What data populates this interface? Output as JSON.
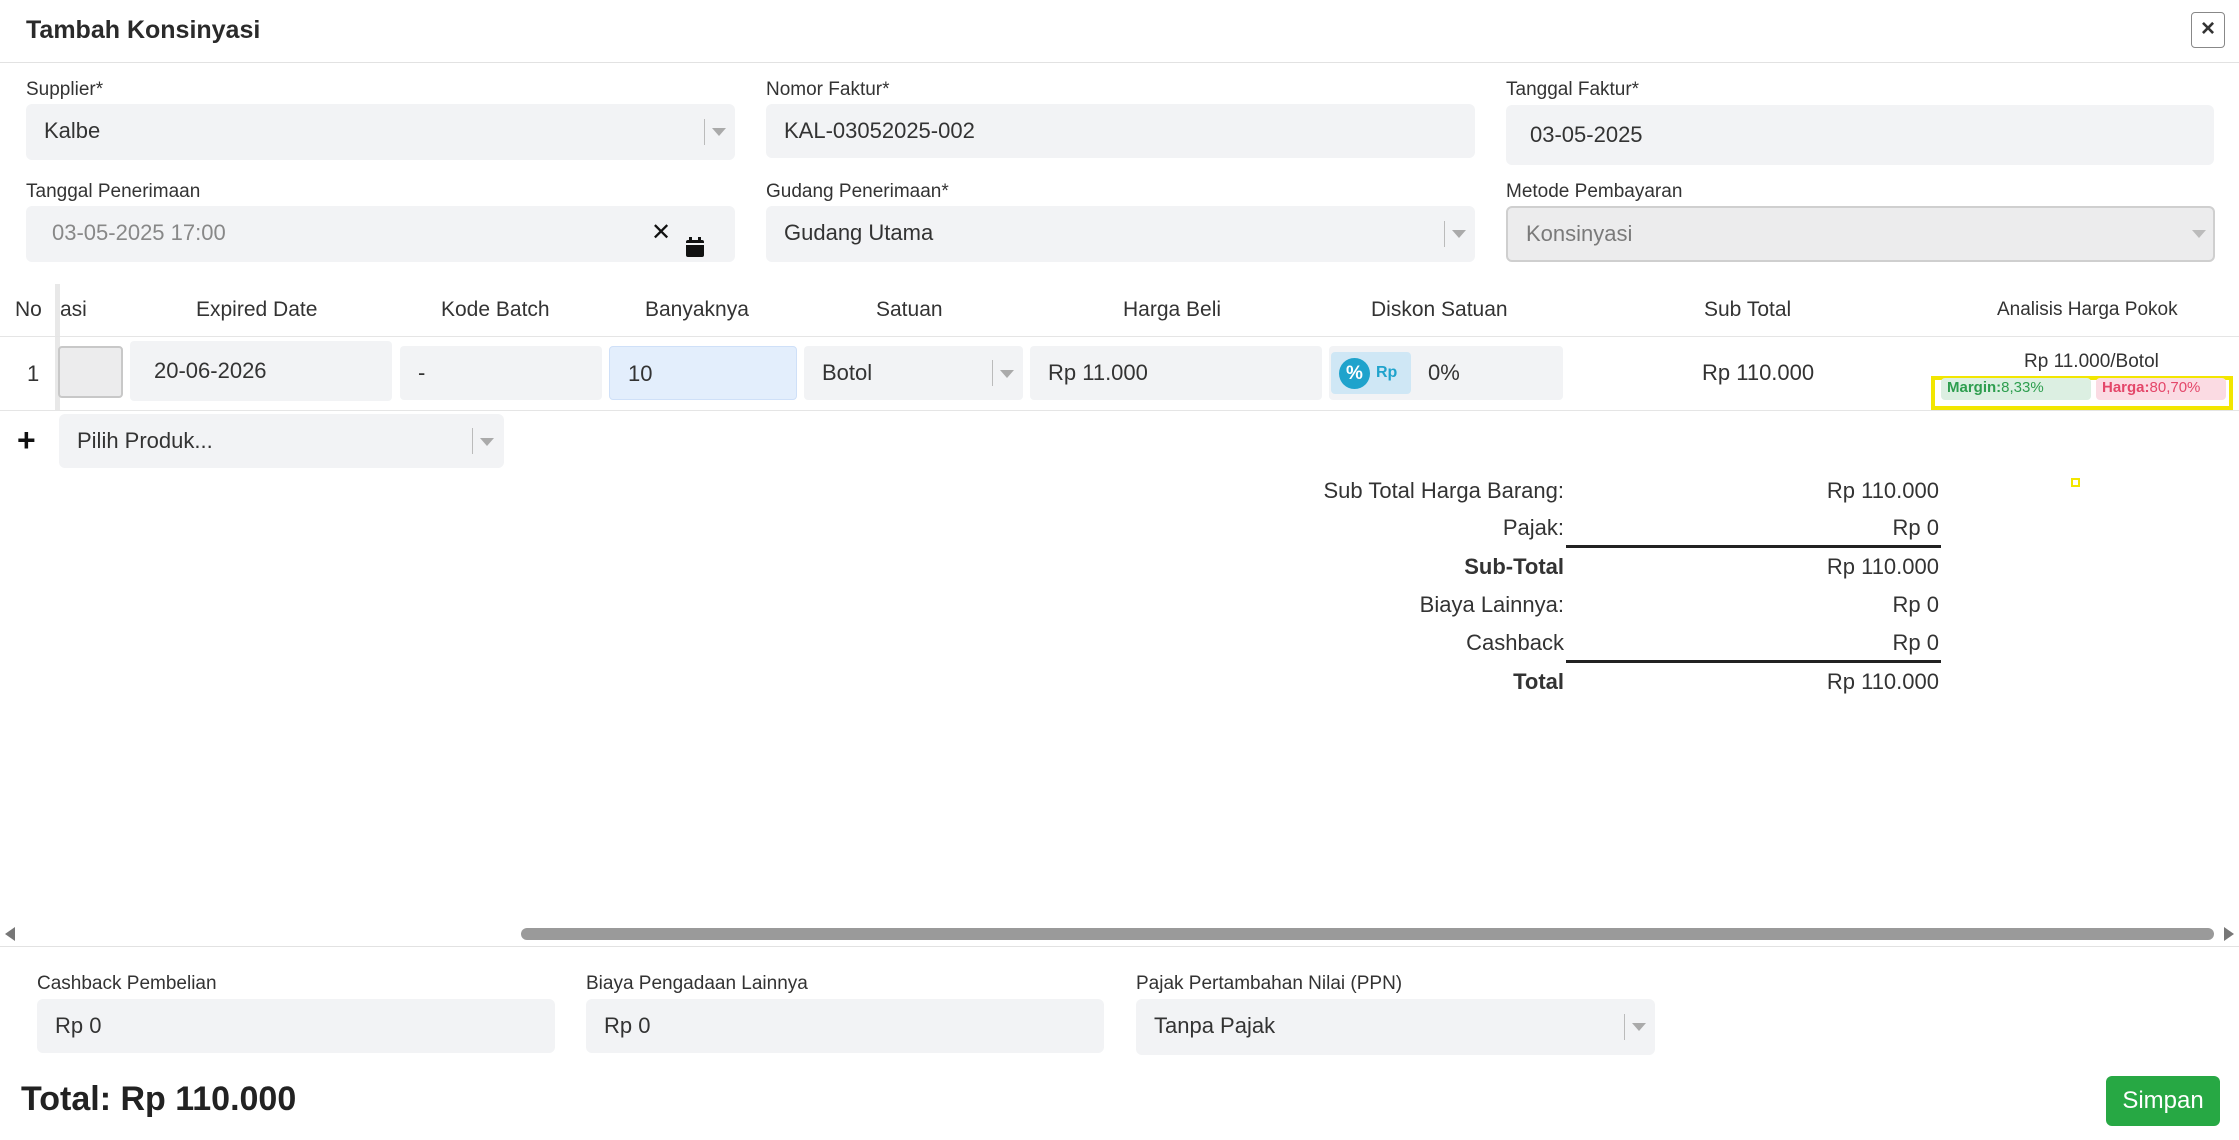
{
  "dialog": {
    "title": "Tambah Konsinyasi",
    "close_label": "×"
  },
  "form": {
    "supplier": {
      "label": "Supplier*",
      "value": "Kalbe"
    },
    "nomor_faktur": {
      "label": "Nomor Faktur*",
      "value": "KAL-03052025-002"
    },
    "tanggal_faktur": {
      "label": "Tanggal Faktur*",
      "value": "03-05-2025"
    },
    "tanggal_penerimaan": {
      "label": "Tanggal Penerimaan",
      "value": "03-05-2025 17:00"
    },
    "gudang_penerimaan": {
      "label": "Gudang Penerimaan*",
      "value": "Gudang Utama"
    },
    "metode_pembayaran": {
      "label": "Metode Pembayaran",
      "value": "Konsinyasi"
    }
  },
  "table": {
    "headers": {
      "no": "No",
      "lokasi": "asi",
      "expired": "Expired Date",
      "batch": "Kode Batch",
      "qty": "Banyaknya",
      "unit": "Satuan",
      "price": "Harga Beli",
      "discount": "Diskon Satuan",
      "subtotal": "Sub Total",
      "analysis": "Analisis Harga Pokok"
    },
    "rows": [
      {
        "no": "1",
        "expired": "20-06-2026",
        "batch": "-",
        "qty": "10",
        "unit": "Botol",
        "price": "Rp 11.000",
        "discount_mode_pct": "%",
        "discount_mode_rp": "Rp",
        "discount": "0%",
        "subtotal": "Rp 110.000",
        "analysis_price": "Rp 11.000/Botol",
        "margin_label": "Margin:",
        "margin_value": "8,33%",
        "harga_label": "Harga:",
        "harga_value": "80,70%"
      }
    ],
    "add_icon": "+",
    "product_placeholder": "Pilih Produk..."
  },
  "summary": {
    "sub_total_barang_label": "Sub Total Harga Barang:",
    "sub_total_barang": "Rp 110.000",
    "pajak_label": "Pajak:",
    "pajak": "Rp 0",
    "sub_total_label": "Sub-Total",
    "sub_total": "Rp 110.000",
    "biaya_lainnya_label": "Biaya Lainnya:",
    "biaya_lainnya": "Rp 0",
    "cashback_label": "Cashback",
    "cashback": "Rp 0",
    "total_label": "Total",
    "total": "Rp 110.000"
  },
  "footer": {
    "cashback_pembelian": {
      "label": "Cashback Pembelian",
      "value": "Rp 0"
    },
    "biaya_pengadaan": {
      "label": "Biaya Pengadaan Lainnya",
      "value": "Rp 0"
    },
    "ppn": {
      "label": "Pajak Pertambahan Nilai (PPN)",
      "value": "Tanpa Pajak"
    },
    "total_text": "Total: Rp 110.000",
    "save_label": "Simpan"
  },
  "colors": {
    "save_green": "#27a844",
    "margin_green": "#2e9e4f",
    "harga_red": "#e4476a",
    "highlight_yellow": "#f2e600",
    "qty_blue_bg": "#e3eefc",
    "discount_pct_blue": "#1fa3cc"
  }
}
